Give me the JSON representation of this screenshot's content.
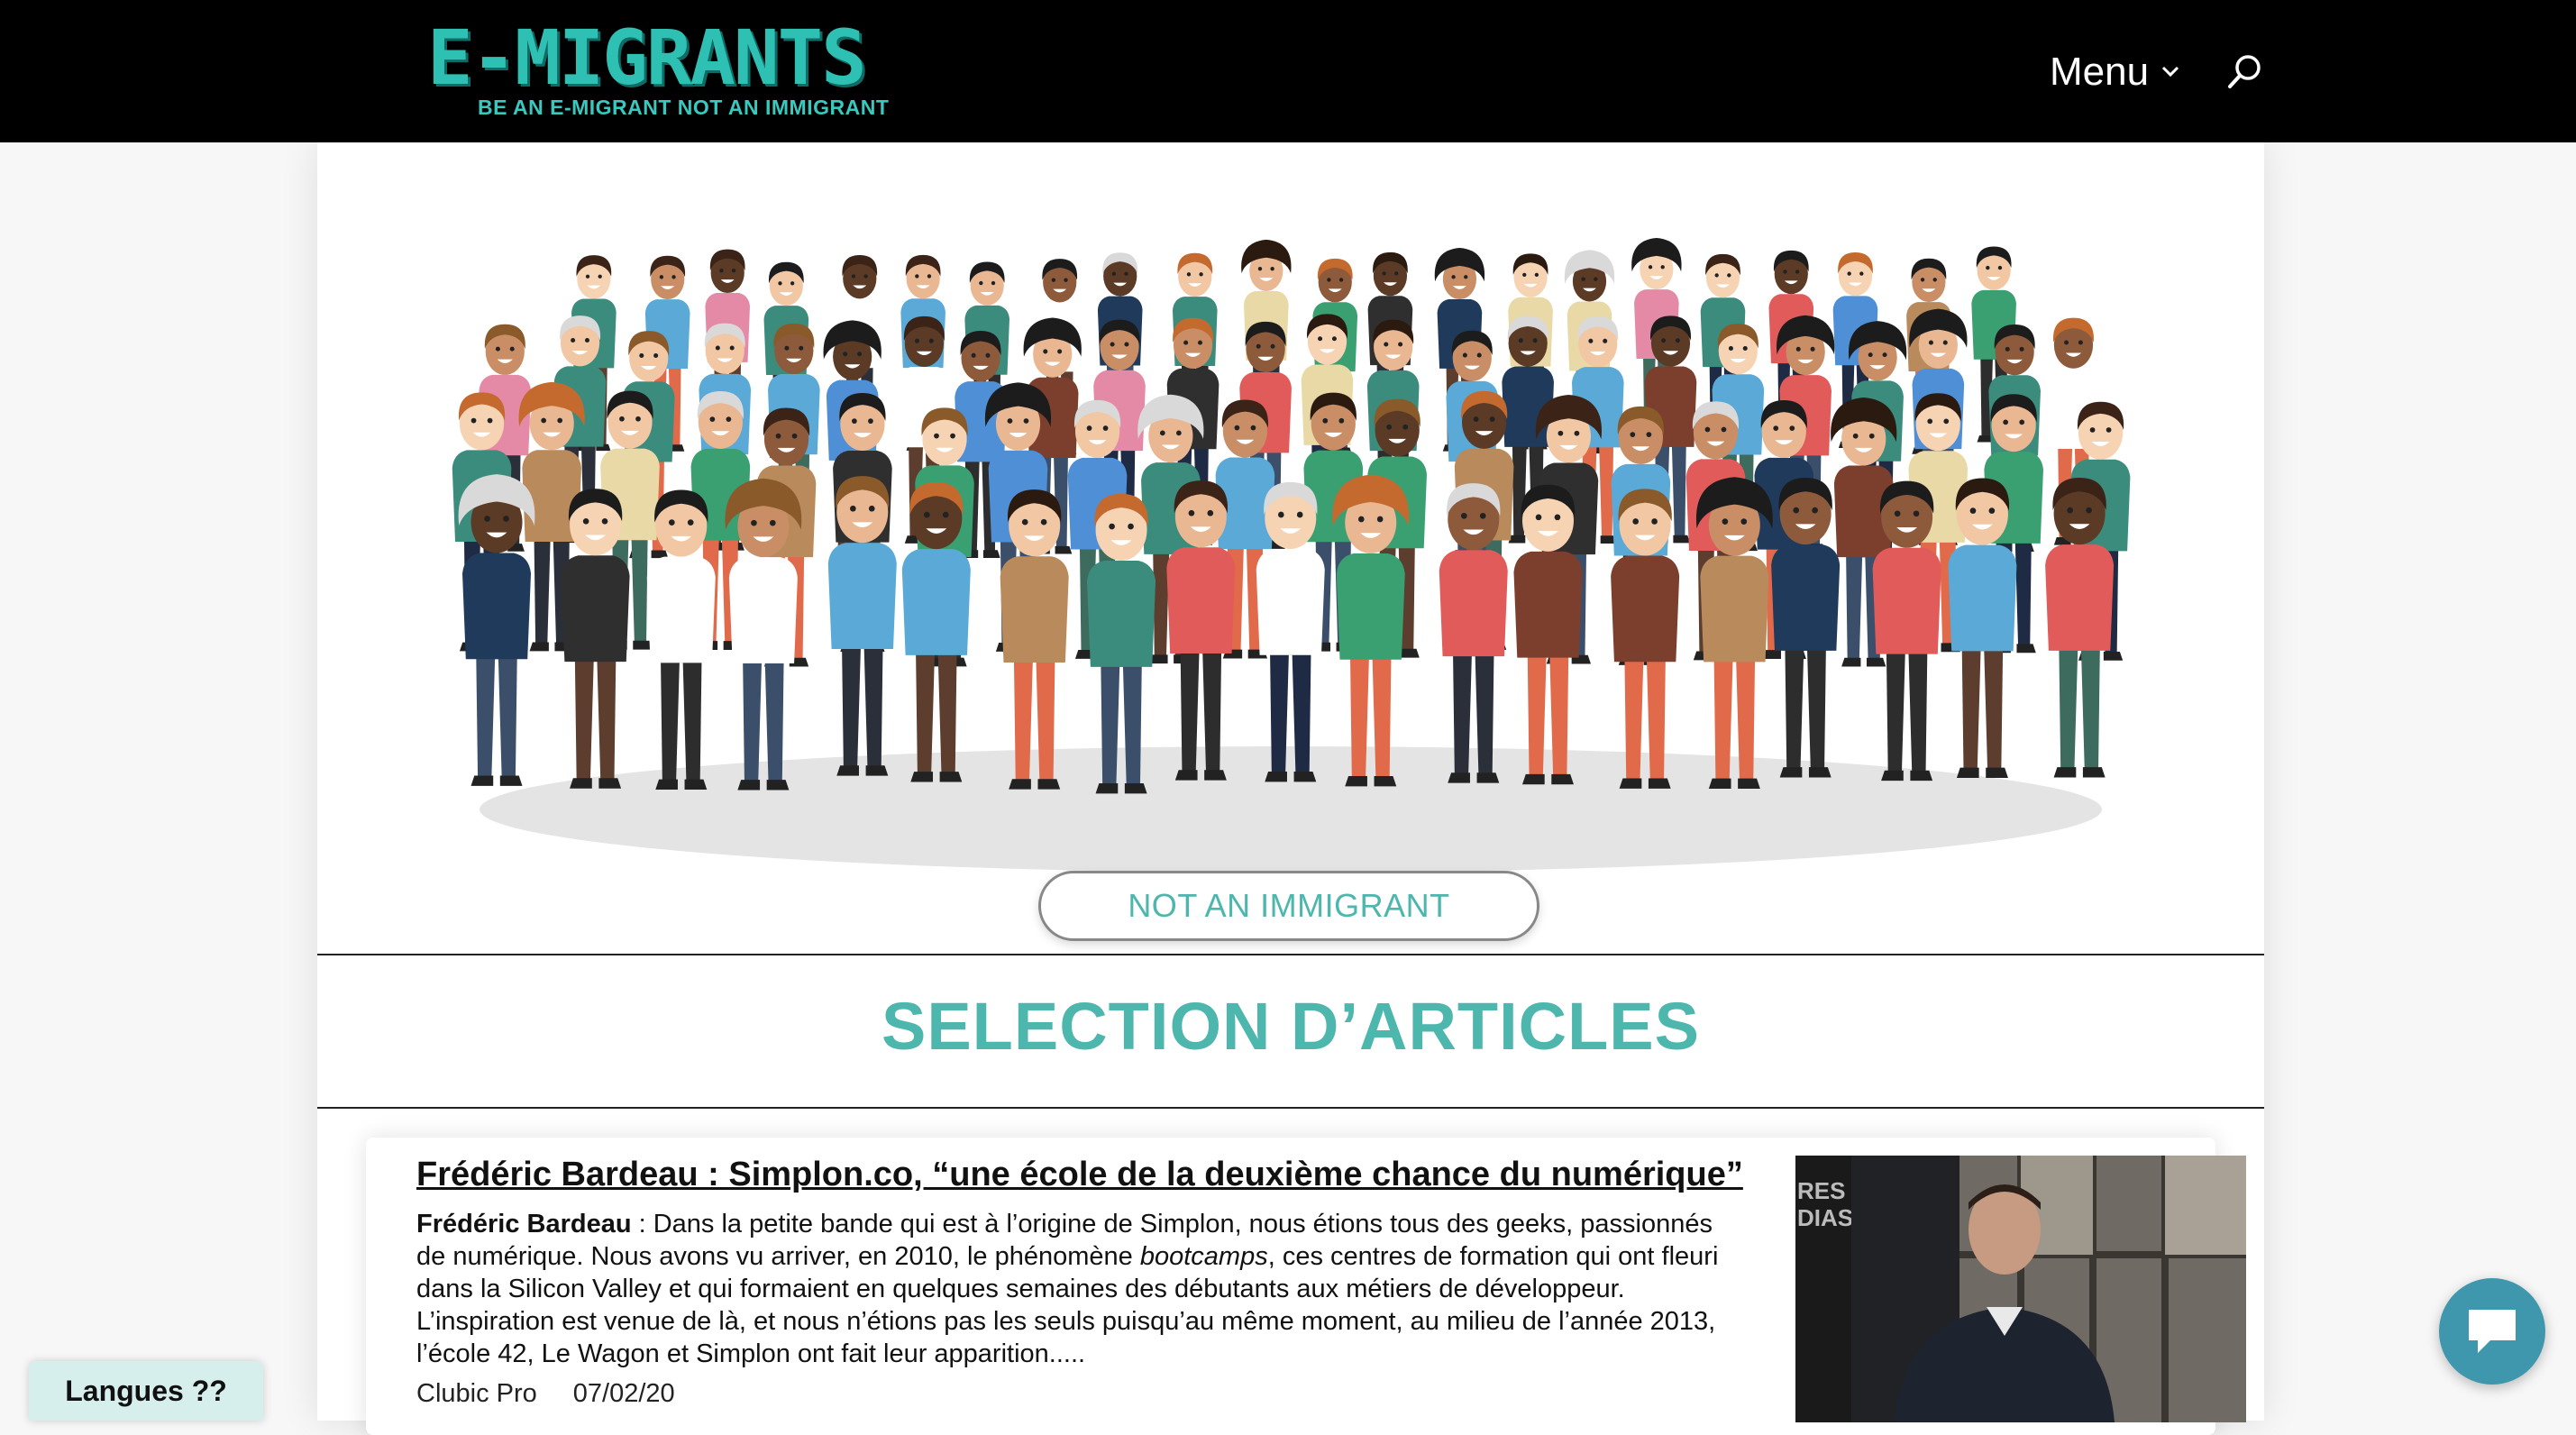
{
  "header": {
    "logo_title": "E-MIGRANTS",
    "logo_subtitle": "BE AN E-MIGRANT NOT AN IMMIGRANT",
    "menu_label": "Menu",
    "icons": [
      "chevron-down-icon",
      "search-icon"
    ]
  },
  "hero": {
    "illustration": "crowd-of-diverse-people-illustration",
    "cta_label": "NOT AN IMMIGRANT"
  },
  "section": {
    "title": "SELECTION D’ARTICLES"
  },
  "article": {
    "title": "Frédéric Bardeau : Simplon.co, “une école de la deuxième chance du numérique”",
    "author_bold": "Frédéric Bardeau",
    "text_1": " : Dans la petite bande qui est à l’origine de Simplon, nous étions tous des geeks, passionnés de numérique. Nous avons vu arriver, en 2010, le phénomène ",
    "text_em": "bootcamps",
    "text_2": ", ces centres de formation qui ont fleuri dans la Silicon Valley et qui formaient en quelques semaines des débutants aux métiers de développeur. L’inspiration est venue de là, et nous n’étions pas les seuls puisqu’au même moment, au milieu de l’année 2013, l’école 42, Le Wagon et Simplon ont fait leur apparition.....",
    "source": "Clubic Pro",
    "date": "07/02/20",
    "image_text": "RES DIAS"
  },
  "floating": {
    "language_label": "Langues ??",
    "chat_icon": "chat-bubble-icon"
  },
  "colors": {
    "header_bg": "#000000",
    "accent": "#4db6ad",
    "logo": "#2fc0b4",
    "chat": "#3e97ad",
    "language_bg": "#d6efed"
  }
}
